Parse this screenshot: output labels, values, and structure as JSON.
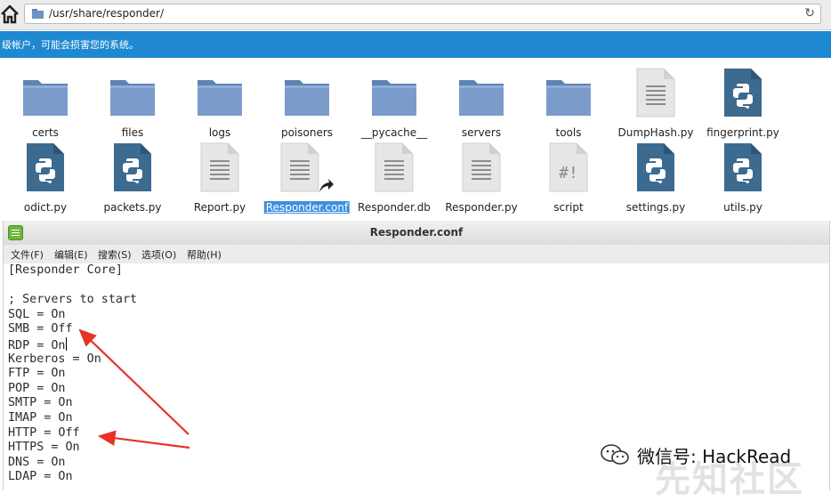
{
  "file_manager": {
    "location_path": "/usr/share/responder/",
    "banner_text": "级帐户，可能会损害您的系统。",
    "items": [
      {
        "name": "certs",
        "type": "folder"
      },
      {
        "name": "files",
        "type": "folder"
      },
      {
        "name": "logs",
        "type": "folder"
      },
      {
        "name": "poisoners",
        "type": "folder"
      },
      {
        "name": "__pycache__",
        "type": "folder"
      },
      {
        "name": "servers",
        "type": "folder"
      },
      {
        "name": "tools",
        "type": "folder"
      },
      {
        "name": "DumpHash.py",
        "type": "text"
      },
      {
        "name": "fingerprint.py",
        "type": "python"
      },
      {
        "name": "odict.py",
        "type": "python"
      },
      {
        "name": "packets.py",
        "type": "python"
      },
      {
        "name": "Report.py",
        "type": "text"
      },
      {
        "name": "Responder.conf",
        "type": "text-link",
        "selected": true
      },
      {
        "name": "Responder.db",
        "type": "text"
      },
      {
        "name": "Responder.py",
        "type": "text"
      },
      {
        "name": "script",
        "type": "script"
      },
      {
        "name": "settings.py",
        "type": "python"
      },
      {
        "name": "utils.py",
        "type": "python"
      }
    ]
  },
  "editor": {
    "title": "Responder.conf",
    "menu": [
      "文件(F)",
      "编辑(E)",
      "搜索(S)",
      "选项(O)",
      "帮助(H)"
    ],
    "lines": [
      "[Responder Core]",
      "",
      "; Servers to start",
      "SQL = On",
      "SMB = Off",
      "RDP = On",
      "Kerberos = On",
      "FTP = On",
      "POP = On",
      "SMTP = On",
      "IMAP = On",
      "HTTP = Off",
      "HTTPS = On",
      "DNS = On",
      "LDAP = On"
    ],
    "caret_line": 5
  },
  "watermark": {
    "text": "微信号: HackRead",
    "background_text": "先知社区"
  },
  "colors": {
    "banner": "#1e88d0",
    "selection": "#3d8fe0",
    "folder": "#6f93bf",
    "python_icon": "#3d6a8f",
    "arrow": "#e63325"
  }
}
